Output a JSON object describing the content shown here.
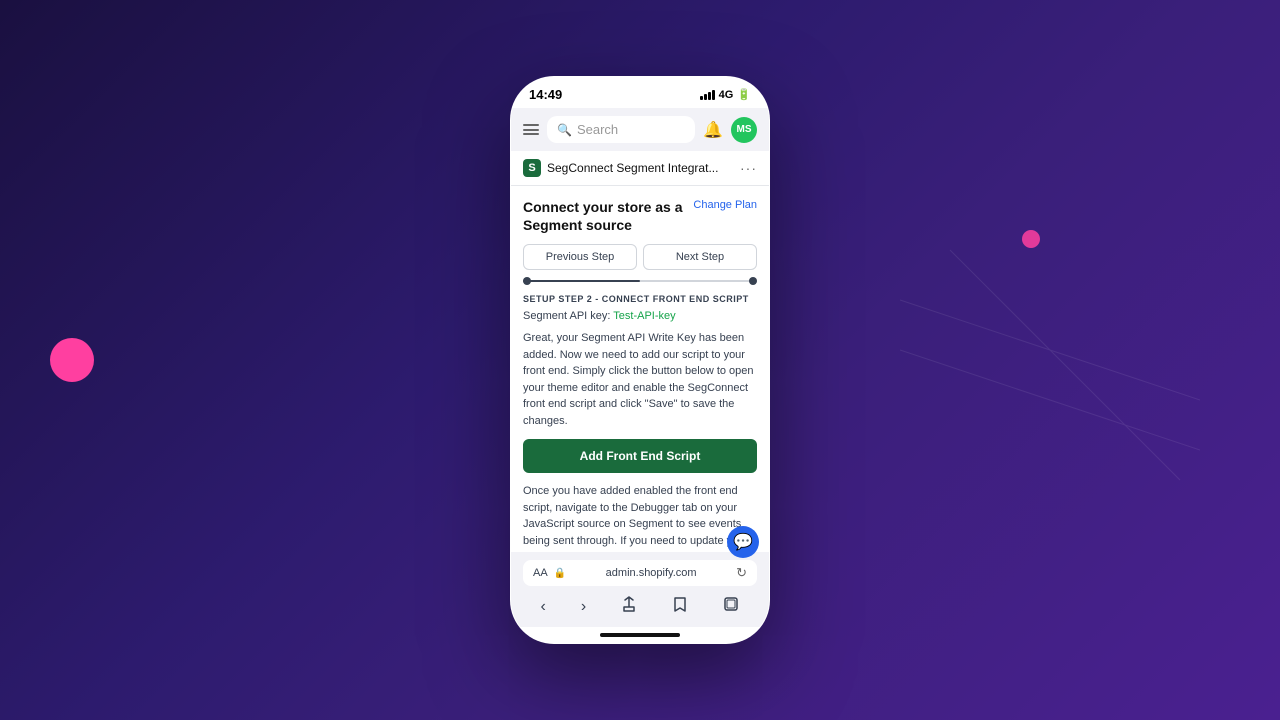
{
  "background": {
    "gradient_from": "#1a1040",
    "gradient_to": "#4a2090"
  },
  "status_bar": {
    "time": "14:49",
    "network": "4G"
  },
  "browser": {
    "search_placeholder": "Search",
    "avatar_initials": "MS",
    "avatar_bg": "#22c55e"
  },
  "app": {
    "icon_letter": "S",
    "icon_bg": "#1a6b3c",
    "title": "SegConnect Segment Integrat...",
    "more_icon": "···"
  },
  "page": {
    "section_title": "Connect your store as a Segment source",
    "change_plan": "Change Plan",
    "prev_step": "Previous Step",
    "next_step": "Next Step",
    "setup_label": "SETUP STEP 2 - CONNECT FRONT END SCRIPT",
    "api_key_label": "Segment API key:",
    "api_key_value": "Test-API-key",
    "description": "Great, your Segment API Write Key has been added. Now we need to add our script to your front end. Simply click the button below to open your theme editor and enable the SegConnect front end script and click \"Save\" to save the changes.",
    "add_script_btn": "Add Front End Script",
    "bottom_description": "Once you have added enabled the front end script, navigate to the Debugger tab on your JavaScript source on Segment to see events being sent through. If you need to update your API key, you can do so by going back to the"
  },
  "url_bar": {
    "aa_label": "AA",
    "url": "admin.shopify.com"
  },
  "icons": {
    "hamburger": "☰",
    "search": "🔍",
    "bell": "🔔",
    "chat": "💬",
    "back": "‹",
    "forward": "›",
    "share": "↑",
    "book": "📖",
    "tabs": "⊞",
    "lock": "🔒",
    "reload": "↻"
  }
}
